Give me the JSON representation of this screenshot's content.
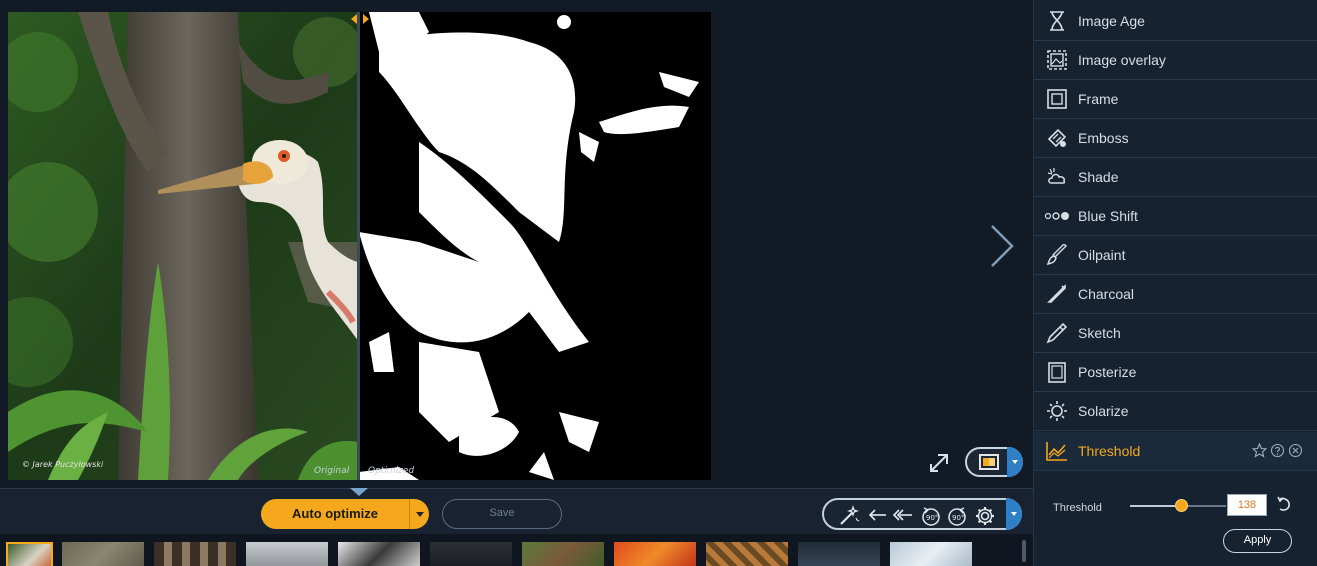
{
  "preview": {
    "original_label": "Original",
    "optimized_label": "Optimized",
    "copyright": "© Jarek Puczyłowski"
  },
  "effects": [
    {
      "label": "Image Age",
      "icon": "hourglass-icon",
      "active": false
    },
    {
      "label": "Image overlay",
      "icon": "image-overlay-icon",
      "active": false
    },
    {
      "label": "Frame",
      "icon": "frame-icon",
      "active": false
    },
    {
      "label": "Emboss",
      "icon": "emboss-icon",
      "active": false
    },
    {
      "label": "Shade",
      "icon": "shade-icon",
      "active": false
    },
    {
      "label": "Blue Shift",
      "icon": "blue-shift-icon",
      "active": false
    },
    {
      "label": "Oilpaint",
      "icon": "oilpaint-brush-icon",
      "active": false
    },
    {
      "label": "Charcoal",
      "icon": "charcoal-icon",
      "active": false
    },
    {
      "label": "Sketch",
      "icon": "pencil-icon",
      "active": false
    },
    {
      "label": "Posterize",
      "icon": "posterize-icon",
      "active": false
    },
    {
      "label": "Solarize",
      "icon": "solarize-icon",
      "active": false
    },
    {
      "label": "Threshold",
      "icon": "threshold-chart-icon",
      "active": true
    }
  ],
  "threshold": {
    "label": "Threshold",
    "value": "138",
    "level_fraction": 0.54,
    "apply_label": "Apply"
  },
  "toolbar": {
    "auto_optimize_label": "Auto optimize",
    "save_label": "Save"
  },
  "colors": {
    "accent": "#f5a81c",
    "panel_bg": "#172230",
    "canvas_bg": "#121a25",
    "dropdown_blue": "#2f7fc7"
  }
}
